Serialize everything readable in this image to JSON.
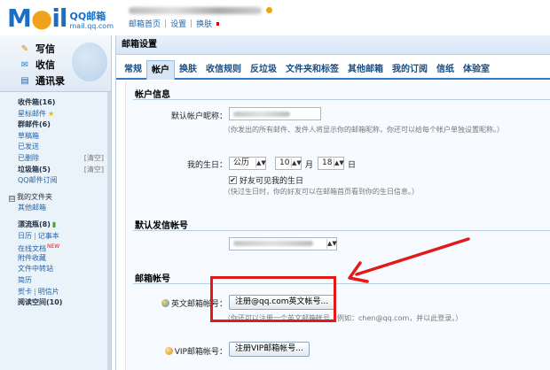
{
  "header": {
    "logo_text": "Mail",
    "logo_cn": "QQ邮箱",
    "logo_url": "mail.qq.com",
    "links": [
      "邮箱首页",
      "设置",
      "换肤"
    ]
  },
  "sidebar": {
    "quick": [
      {
        "label": "写信",
        "icon": "pen-icon"
      },
      {
        "label": "收信",
        "icon": "inbox-icon"
      },
      {
        "label": "通讯录",
        "icon": "contacts-icon"
      }
    ],
    "folders": {
      "inbox": "收件箱(16)",
      "starred": "星标邮件",
      "group": "群邮件(6)",
      "drafts": "草稿箱",
      "sent": "已发送",
      "deleted": "已删除",
      "deleted_clear": "[清空]",
      "spam": "垃圾箱(5)",
      "spam_clear": "[清空]",
      "subscribe": "QQ邮件订阅",
      "my_folders": "我的文件夹",
      "other": "其他邮箱",
      "drift": "漂流瓶(8)",
      "calendar": "日历",
      "notebook": "记事本",
      "online_doc": "在线文档",
      "new_badge": "NEW",
      "favorites": "附件收藏",
      "transfer": "文件中转站",
      "resume": "简历",
      "card": "贺卡",
      "postcard": "明信片",
      "reading": "阅读空间(10)"
    }
  },
  "main": {
    "title": "邮箱设置",
    "tabs": [
      "常规",
      "帐户",
      "换肤",
      "收信规则",
      "反垃圾",
      "文件夹和标签",
      "其他邮箱",
      "我的订阅",
      "信纸",
      "体验室"
    ],
    "active_tab": "帐户",
    "account_info": {
      "title": "帐户信息",
      "nickname_label": "默认帐户昵称：",
      "nickname_hint": "（你发出的所有邮件、发件人将显示你的邮箱昵称，你还可以给每个帐户单独设置昵称。）",
      "birthday_label": "我的生日：",
      "calendar_type": "公历",
      "month": "10",
      "month_unit": "月",
      "day": "18",
      "day_unit": "日",
      "birthday_checkbox": "好友可见我的生日",
      "birthday_hint": "（快过生日时，你的好友可以在邮箱首页看到你的生日信息。）"
    },
    "default_sender": {
      "title": "默认发信帐号"
    },
    "mail_accounts": {
      "title": "邮箱帐号",
      "english_label": "英文邮箱帐号：",
      "english_button": "注册@qq.com英文帐号...",
      "english_hint": "（你还可以注册一个英文邮箱帐号，例如：chen@qq.com，并以此登录。）",
      "vip_label": "VIP邮箱帐号：",
      "vip_button": "注册VIP邮箱帐号..."
    }
  },
  "colors": {
    "accent": "#2f7ac9",
    "annotation": "#e21a1a"
  }
}
